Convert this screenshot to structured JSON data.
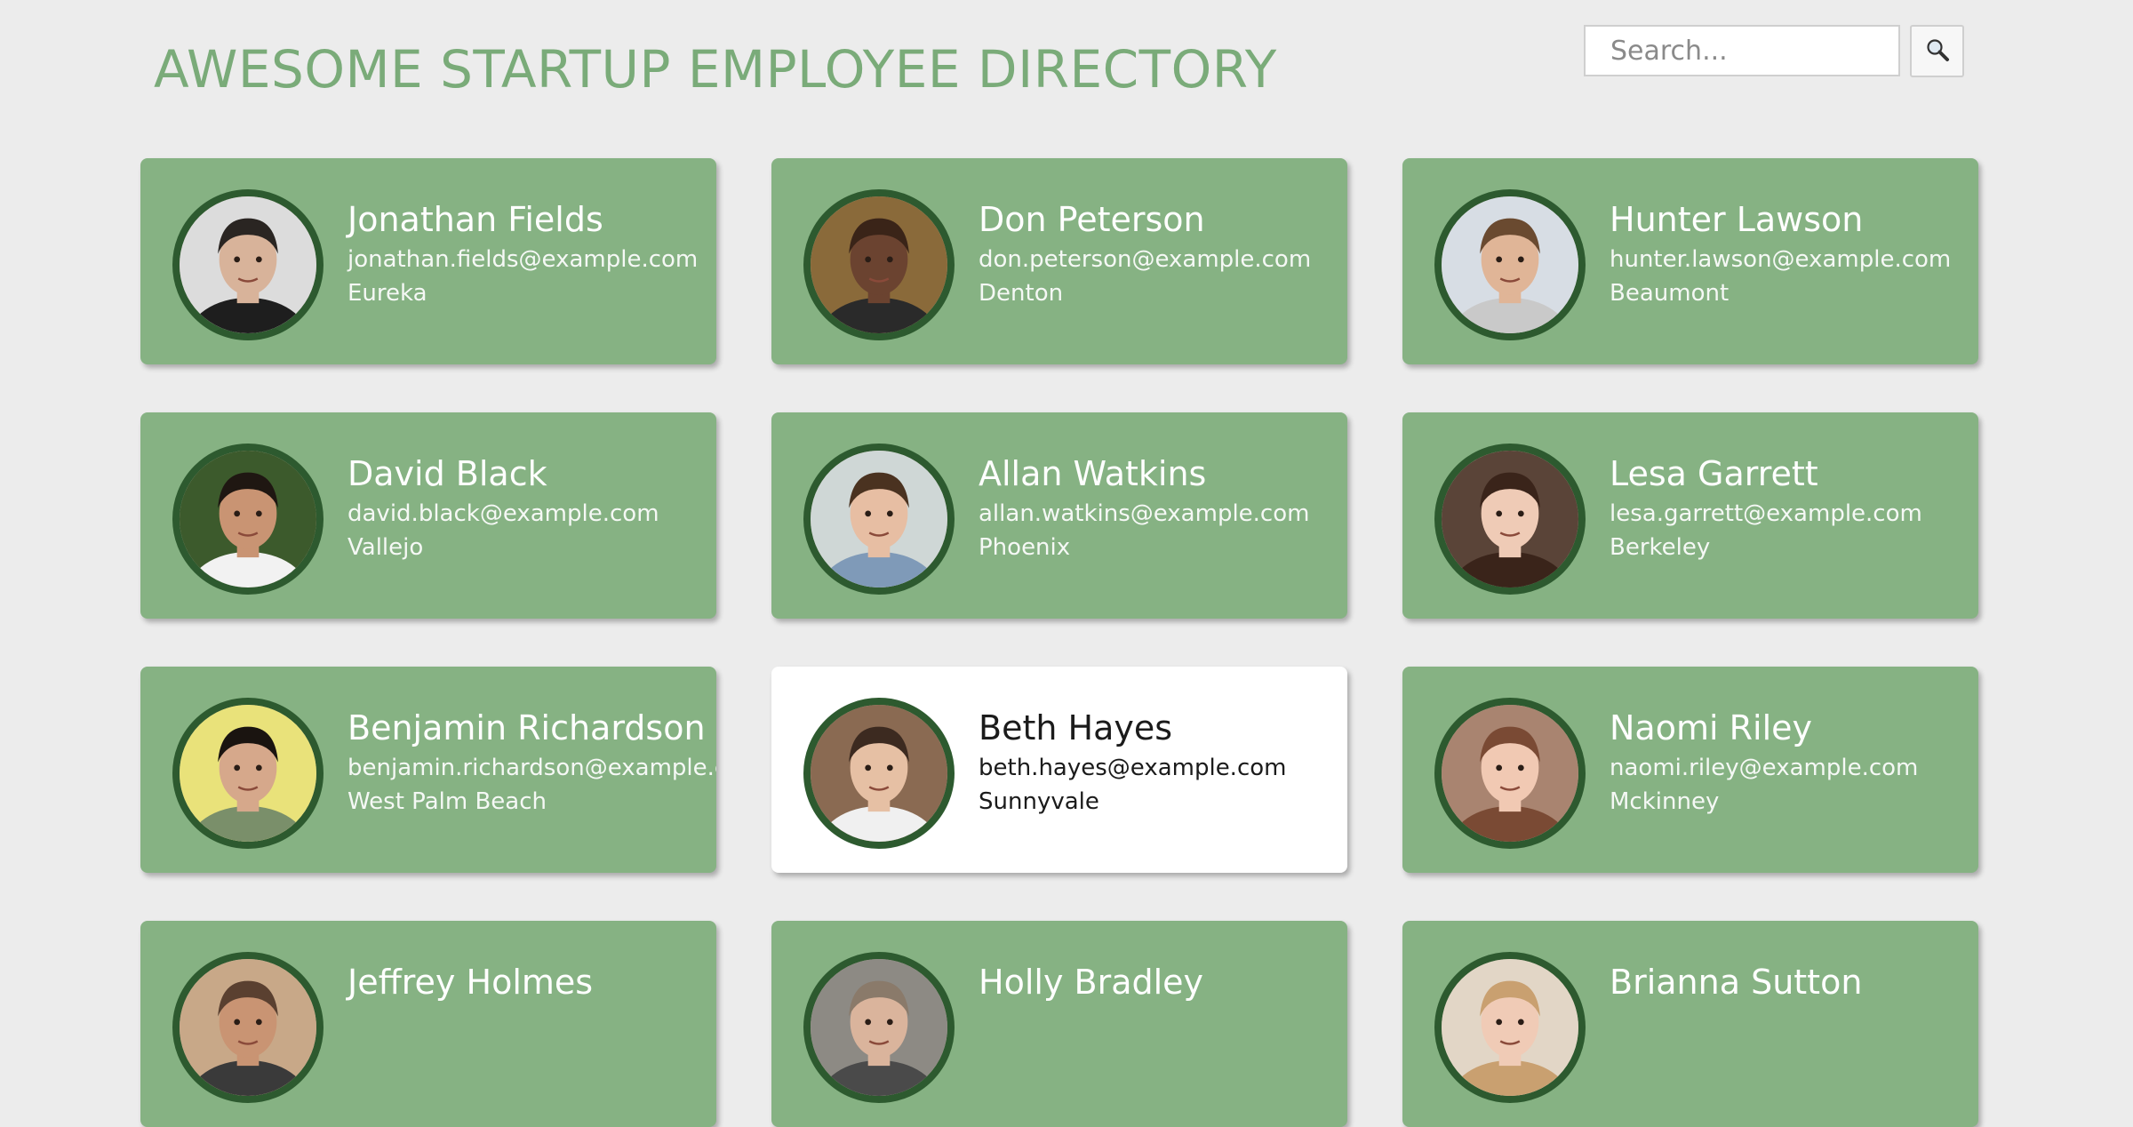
{
  "header": {
    "title": "AWESOME STARTUP EMPLOYEE DIRECTORY"
  },
  "search": {
    "placeholder": "Search...",
    "value": "",
    "button_icon": "search-icon"
  },
  "colors": {
    "card": "#86b283",
    "card_selected": "#ffffff",
    "title": "#7aab79",
    "avatar_ring": "#2d5a2f",
    "background": "#ececec"
  },
  "employees": [
    {
      "name": "Jonathan Fields",
      "email": "jonathan.fields@example.com",
      "city": "Eureka",
      "selected": false,
      "skin": "#d8b39a",
      "hair": "#2a2522",
      "bg": "#dcdcdc",
      "shirt": "#1e1e1e"
    },
    {
      "name": "Don Peterson",
      "email": "don.peterson@example.com",
      "city": "Denton",
      "selected": false,
      "skin": "#6b4330",
      "hair": "#3a2418",
      "bg": "#8a6a3a",
      "shirt": "#2a2a2a"
    },
    {
      "name": "Hunter Lawson",
      "email": "hunter.lawson@example.com",
      "city": "Beaumont",
      "selected": false,
      "skin": "#e0b597",
      "hair": "#6a4a30",
      "bg": "#d7dde4",
      "shirt": "#c9c9c9"
    },
    {
      "name": "David Black",
      "email": "david.black@example.com",
      "city": "Vallejo",
      "selected": false,
      "skin": "#c99473",
      "hair": "#1f1712",
      "bg": "#3c5a2c",
      "shirt": "#f2f2f2"
    },
    {
      "name": "Allan Watkins",
      "email": "allan.watkins@example.com",
      "city": "Phoenix",
      "selected": false,
      "skin": "#e7bea3",
      "hair": "#4a3220",
      "bg": "#cfd7d6",
      "shirt": "#7f9ab8"
    },
    {
      "name": "Lesa Garrett",
      "email": "lesa.garrett@example.com",
      "city": "Berkeley",
      "selected": false,
      "skin": "#efcbb6",
      "hair": "#3a241a",
      "bg": "#5a4438",
      "shirt": "#3a241a"
    },
    {
      "name": "Benjamin Richardson",
      "email": "benjamin.richardson@example.com",
      "city": "West Palm Beach",
      "selected": false,
      "skin": "#d6a88b",
      "hair": "#1a1410",
      "bg": "#e9e27a",
      "shirt": "#7a8f6a"
    },
    {
      "name": "Beth Hayes",
      "email": "beth.hayes@example.com",
      "city": "Sunnyvale",
      "selected": true,
      "skin": "#e6c0a4",
      "hair": "#3c2a20",
      "bg": "#8a6a52",
      "shirt": "#f0f0f0"
    },
    {
      "name": "Naomi Riley",
      "email": "naomi.riley@example.com",
      "city": "Mckinney",
      "selected": false,
      "skin": "#f1c9b3",
      "hair": "#7a4a34",
      "bg": "#a98470",
      "shirt": "#7a4a34"
    },
    {
      "name": "Jeffrey Holmes",
      "email": "",
      "city": "",
      "selected": false,
      "skin": "#c99473",
      "hair": "#5a4030",
      "bg": "#c8a888",
      "shirt": "#3a3a3a"
    },
    {
      "name": "Holly Bradley",
      "email": "",
      "city": "",
      "selected": false,
      "skin": "#dab49c",
      "hair": "#8a7a6a",
      "bg": "#8d8a84",
      "shirt": "#4a4a4a"
    },
    {
      "name": "Brianna Sutton",
      "email": "",
      "city": "",
      "selected": false,
      "skin": "#f0cbb6",
      "hair": "#c9a070",
      "bg": "#e2d6c6",
      "shirt": "#c9a070"
    }
  ]
}
